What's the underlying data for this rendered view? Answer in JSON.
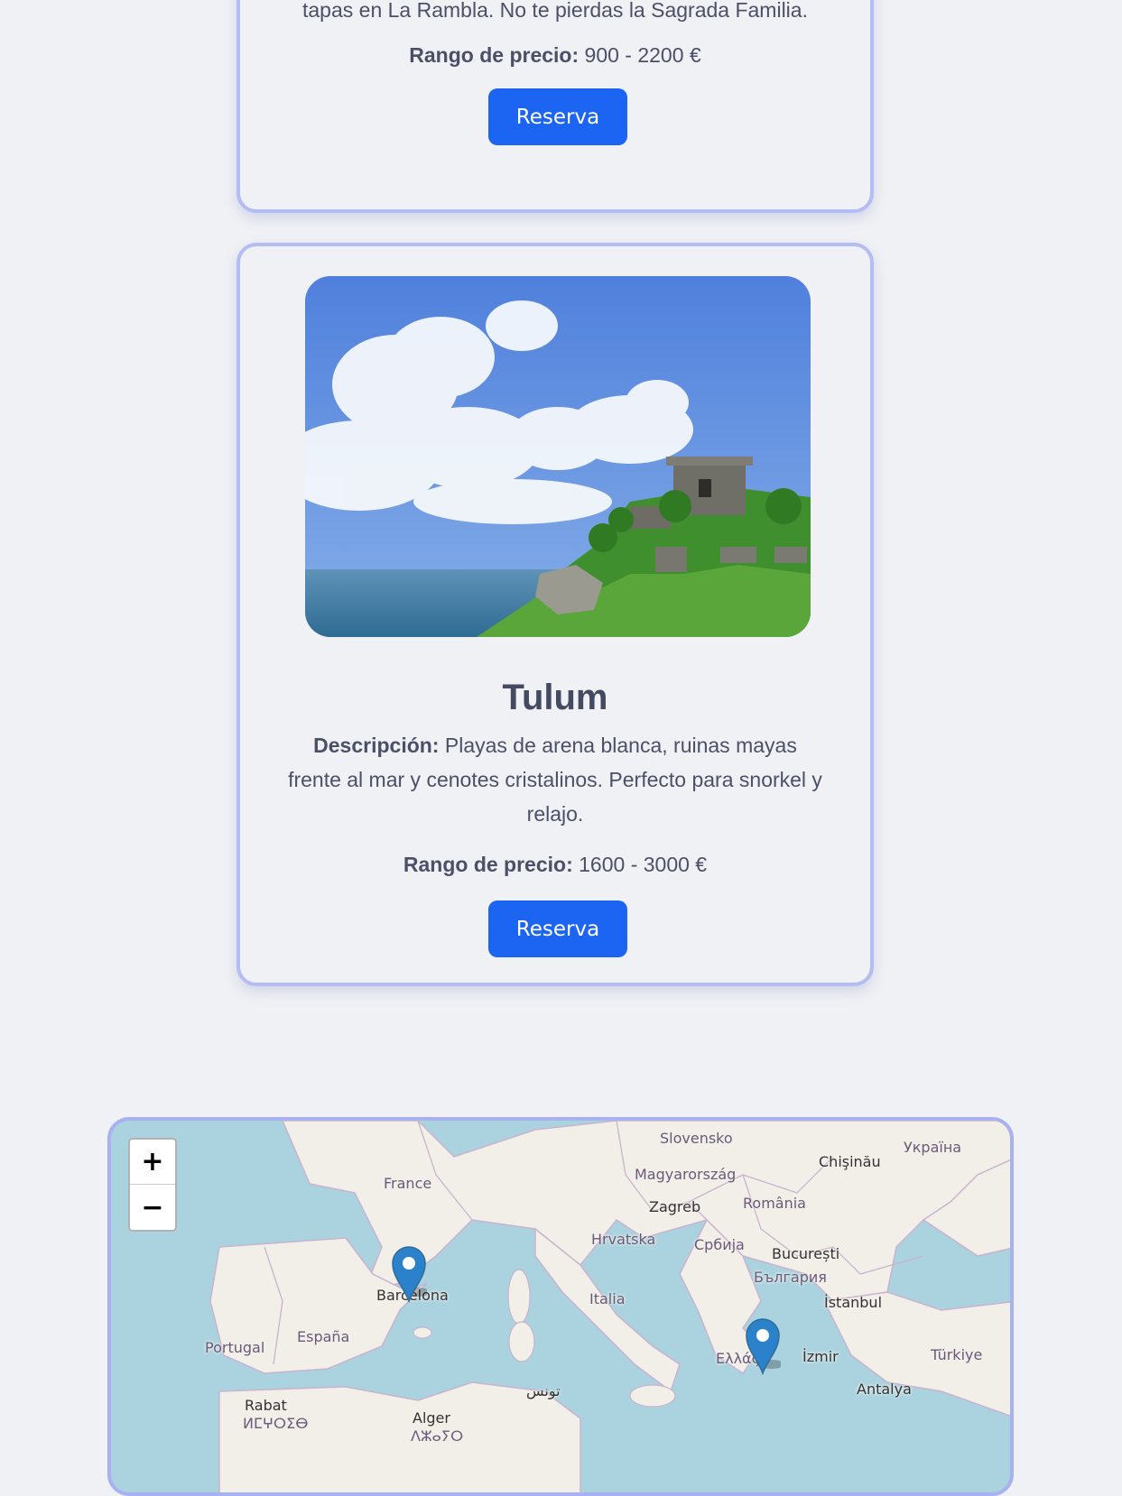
{
  "card_prev": {
    "description_tail": "tapas en La Rambla. No te pierdas la Sagrada Familia.",
    "price_label": "Rango de precio:",
    "price_value": "900 - 2200 €",
    "button_label": "Reserva"
  },
  "card_tulum": {
    "title": "Tulum",
    "description_label": "Descripción:",
    "description_text": "Playas de arena blanca, ruinas mayas frente al mar y cenotes cristalinos. Perfecto para snorkel y relajo.",
    "price_label": "Rango de precio:",
    "price_value": "1600 - 3000 €",
    "button_label": "Reserva",
    "image_icon": "tulum-ruins-photo"
  },
  "map": {
    "zoom_in_label": "+",
    "zoom_out_label": "−",
    "labels": {
      "slovensko": "Slovensko",
      "ukraina": "Україна",
      "france": "France",
      "magyarorszag": "Magyarország",
      "chisinau": "Chişinău",
      "zagreb": "Zagreb",
      "romania": "România",
      "hrvatska": "Hrvatska",
      "srbija": "Србија",
      "bucuresti": "București",
      "bulgaria": "България",
      "barcelona": "Barcelona",
      "italia": "Italia",
      "istanbul": "İstanbul",
      "portugal": "Portugal",
      "espana": "España",
      "ellada": "Ελλάς",
      "izmir": "İzmir",
      "turkiye": "Türkiye",
      "antalya": "Antalya",
      "rabat": "Rabat",
      "tunis": "تونس",
      "alger": "Alger",
      "tifinagh1": "ⵍⵎⵖⵔⵉⴱ",
      "tifinagh2": "ⴷⵣⴰⵢⵔ"
    },
    "markers": [
      "barcelona-marker",
      "greece-marker"
    ]
  }
}
